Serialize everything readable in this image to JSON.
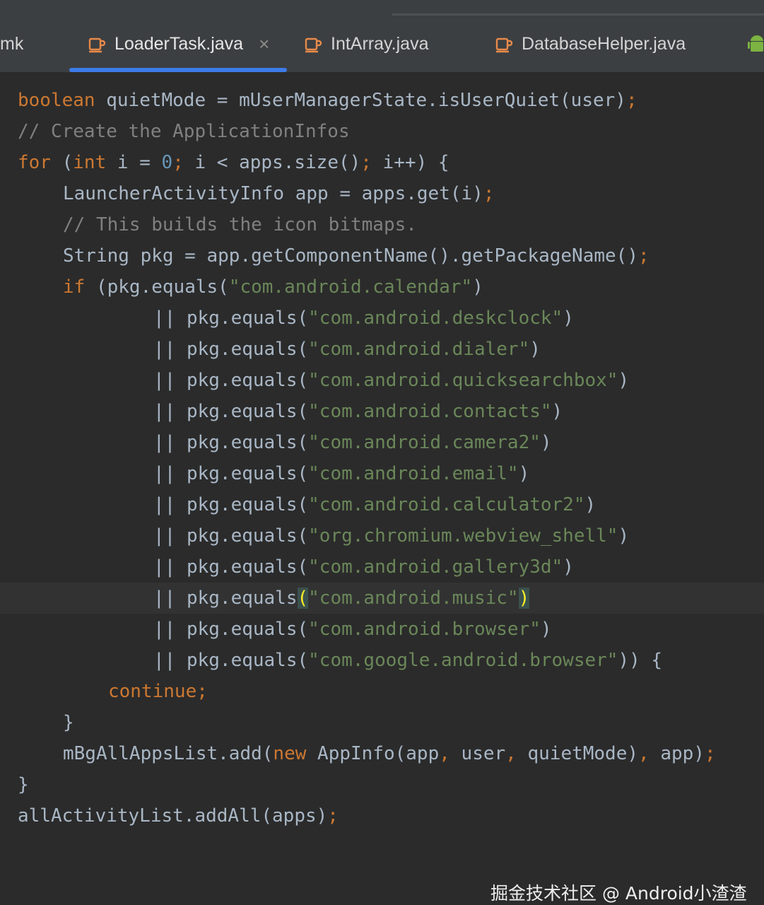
{
  "tabs": [
    {
      "label": "mk",
      "active": false
    },
    {
      "label": "LoaderTask.java",
      "active": true,
      "close": "×"
    },
    {
      "label": "IntArray.java",
      "active": false
    },
    {
      "label": "DatabaseHelper.java",
      "active": false
    }
  ],
  "editor": {
    "lines": [
      {
        "indent": 0,
        "tokens": [
          [
            "kw",
            "boolean"
          ],
          [
            "p",
            " quietMode = mUserManagerState.isUserQuiet(user)"
          ],
          [
            "semi",
            ";"
          ]
        ]
      },
      {
        "indent": 0,
        "tokens": [
          [
            "cmt",
            "// Create the ApplicationInfos"
          ]
        ]
      },
      {
        "indent": 0,
        "tokens": [
          [
            "kw",
            "for"
          ],
          [
            "p",
            " ("
          ],
          [
            "kw",
            "int"
          ],
          [
            "p",
            " i = "
          ],
          [
            "num",
            "0"
          ],
          [
            "semi",
            ";"
          ],
          [
            "p",
            " i < apps.size()"
          ],
          [
            "semi",
            ";"
          ],
          [
            "p",
            " i++) {"
          ]
        ]
      },
      {
        "indent": 1,
        "tokens": [
          [
            "p",
            "LauncherActivityInfo app = apps.get(i)"
          ],
          [
            "semi",
            ";"
          ]
        ]
      },
      {
        "indent": 1,
        "tokens": [
          [
            "cmt",
            "// This builds the icon bitmaps."
          ]
        ]
      },
      {
        "indent": 1,
        "tokens": [
          [
            "p",
            "String pkg = app.getComponentName().getPackageName()"
          ],
          [
            "semi",
            ";"
          ]
        ]
      },
      {
        "indent": 1,
        "tokens": [
          [
            "kw",
            "if"
          ],
          [
            "p",
            " (pkg.equals("
          ],
          [
            "str",
            "\"com.android.calendar\""
          ],
          [
            "p",
            ")"
          ]
        ]
      },
      {
        "indent": 3,
        "tokens": [
          [
            "p",
            "|| pkg.equals("
          ],
          [
            "str",
            "\"com.android.deskclock\""
          ],
          [
            "p",
            ")"
          ]
        ]
      },
      {
        "indent": 3,
        "tokens": [
          [
            "p",
            "|| pkg.equals("
          ],
          [
            "str",
            "\"com.android.dialer\""
          ],
          [
            "p",
            ")"
          ]
        ]
      },
      {
        "indent": 3,
        "tokens": [
          [
            "p",
            "|| pkg.equals("
          ],
          [
            "str",
            "\"com.android.quicksearchbox\""
          ],
          [
            "p",
            ")"
          ]
        ]
      },
      {
        "indent": 3,
        "tokens": [
          [
            "p",
            "|| pkg.equals("
          ],
          [
            "str",
            "\"com.android.contacts\""
          ],
          [
            "p",
            ")"
          ]
        ]
      },
      {
        "indent": 3,
        "tokens": [
          [
            "p",
            "|| pkg.equals("
          ],
          [
            "str",
            "\"com.android.camera2\""
          ],
          [
            "p",
            ")"
          ]
        ]
      },
      {
        "indent": 3,
        "tokens": [
          [
            "p",
            "|| pkg.equals("
          ],
          [
            "str",
            "\"com.android.email\""
          ],
          [
            "p",
            ")"
          ]
        ]
      },
      {
        "indent": 3,
        "tokens": [
          [
            "p",
            "|| pkg.equals("
          ],
          [
            "str",
            "\"com.android.calculator2\""
          ],
          [
            "p",
            ")"
          ]
        ]
      },
      {
        "indent": 3,
        "tokens": [
          [
            "p",
            "|| pkg.equals("
          ],
          [
            "str",
            "\"org.chromium.webview_shell\""
          ],
          [
            "p",
            ")"
          ]
        ]
      },
      {
        "indent": 3,
        "tokens": [
          [
            "p",
            "|| pkg.equals("
          ],
          [
            "str",
            "\"com.android.gallery3d\""
          ],
          [
            "p",
            ")"
          ]
        ]
      },
      {
        "indent": 3,
        "current": true,
        "tokens": [
          [
            "p",
            "|| pkg.equals"
          ],
          [
            "hl",
            "("
          ],
          [
            "str",
            "\"com.android.music\""
          ],
          [
            "hl",
            ")"
          ]
        ]
      },
      {
        "indent": 3,
        "tokens": [
          [
            "p",
            "|| pkg.equals("
          ],
          [
            "str",
            "\"com.android.browser\""
          ],
          [
            "p",
            ")"
          ]
        ]
      },
      {
        "indent": 3,
        "tokens": [
          [
            "p",
            "|| pkg.equals("
          ],
          [
            "str",
            "\"com.google.android.browser\""
          ],
          [
            "p",
            ")) {"
          ]
        ]
      },
      {
        "indent": 2,
        "tokens": [
          [
            "kw",
            "continue"
          ],
          [
            "semi",
            ";"
          ]
        ]
      },
      {
        "indent": 1,
        "tokens": [
          [
            "p",
            "}"
          ]
        ]
      },
      {
        "indent": 1,
        "tokens": [
          [
            "p",
            "mBgAllAppsList.add("
          ],
          [
            "kw",
            "new"
          ],
          [
            "p",
            " AppInfo(app"
          ],
          [
            "semi",
            ","
          ],
          [
            "p",
            " user"
          ],
          [
            "semi",
            ","
          ],
          [
            "p",
            " quietMode)"
          ],
          [
            "semi",
            ","
          ],
          [
            "p",
            " app)"
          ],
          [
            "semi",
            ";"
          ]
        ]
      },
      {
        "indent": 0,
        "tokens": [
          [
            "p",
            "}"
          ]
        ]
      },
      {
        "indent": 0,
        "tokens": [
          [
            "p",
            "allActivityList.addAll(apps)"
          ],
          [
            "semi",
            ";"
          ]
        ]
      }
    ]
  },
  "watermark": "掘金技术社区 @ Android小渣渣",
  "colors": {
    "keyword": "#cc7832",
    "string": "#6a8759",
    "number": "#6897bb",
    "comment": "#808080",
    "plain": "#a9b7c6",
    "background": "#2b2b2b",
    "tab_underline": "#3d7be8"
  }
}
